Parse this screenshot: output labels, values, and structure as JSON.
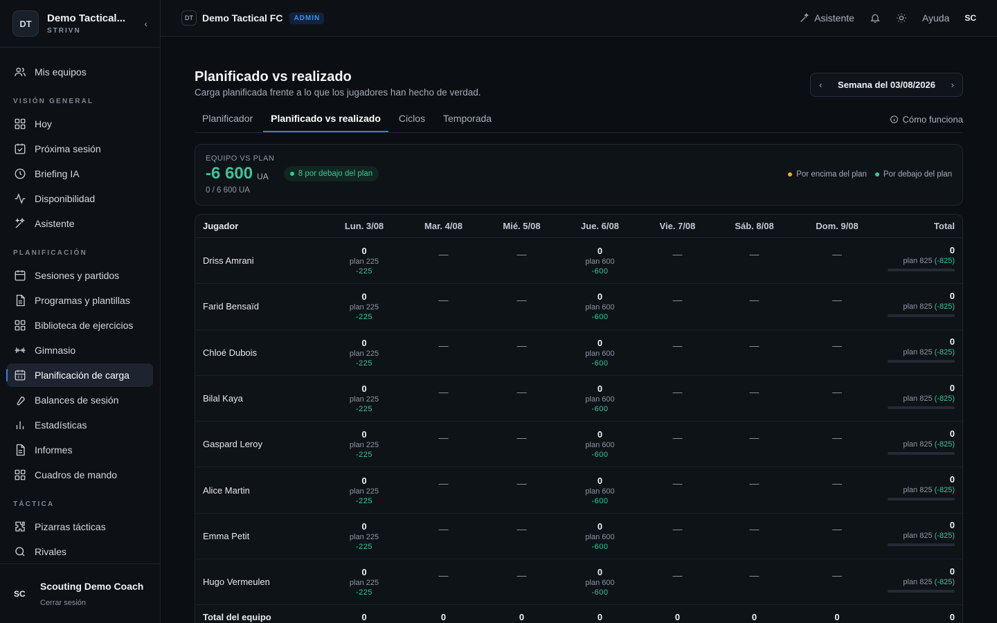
{
  "brand": {
    "logo": "DT",
    "name": "Demo Tactical...",
    "sub": "STRIVN"
  },
  "sidebar": {
    "top_item": {
      "label": "Mis equipos",
      "icon": "users-icon"
    },
    "sections": [
      {
        "title": "VISIÓN GENERAL",
        "items": [
          {
            "label": "Hoy",
            "icon": "grid-icon"
          },
          {
            "label": "Próxima sesión",
            "icon": "calendar-check-icon"
          },
          {
            "label": "Briefing IA",
            "icon": "clock-icon"
          },
          {
            "label": "Disponibilidad",
            "icon": "activity-icon"
          },
          {
            "label": "Asistente",
            "icon": "sparkle-icon"
          }
        ]
      },
      {
        "title": "PLANIFICACIÓN",
        "items": [
          {
            "label": "Sesiones y partidos",
            "icon": "calendar-icon"
          },
          {
            "label": "Programas y plantillas",
            "icon": "document-icon"
          },
          {
            "label": "Biblioteca de ejercicios",
            "icon": "grid-icon"
          },
          {
            "label": "Gimnasio",
            "icon": "dumbbell-icon"
          },
          {
            "label": "Planificación de carga",
            "icon": "calendar-grid-icon",
            "active": true
          },
          {
            "label": "Balances de sesión",
            "icon": "wrench-icon"
          },
          {
            "label": "Estadísticas",
            "icon": "bar-chart-icon"
          },
          {
            "label": "Informes",
            "icon": "document-icon"
          },
          {
            "label": "Cuadros de mando",
            "icon": "grid-icon"
          }
        ]
      },
      {
        "title": "TÁCTICA",
        "items": [
          {
            "label": "Pizarras tácticas",
            "icon": "puzzle-icon"
          },
          {
            "label": "Rivales",
            "icon": "search-icon"
          }
        ]
      }
    ]
  },
  "user": {
    "initials": "SC",
    "name": "Scouting Demo Coach",
    "logout": "Cerrar sesión"
  },
  "topbar": {
    "logo": "DT",
    "team": "Demo Tactical FC",
    "badge": "ADMIN",
    "assistant": "Asistente",
    "help": "Ayuda",
    "initials": "SC"
  },
  "page": {
    "title": "Planificado vs realizado",
    "subtitle": "Carga planificada frente a lo que los jugadores han hecho de verdad.",
    "week": "Semana del 03/08/2026",
    "tabs": [
      "Planificador",
      "Planificado vs realizado",
      "Ciclos",
      "Temporada"
    ],
    "active_tab": 1,
    "how": "Cómo funciona"
  },
  "summary": {
    "label": "EQUIPO VS PLAN",
    "value": "-6 600",
    "unit": "UA",
    "badge": "8 por debajo del plan",
    "total": "0 / 6 600 UA",
    "legend_above": "Por encima del plan",
    "legend_below": "Por debajo del plan",
    "color_above": "#f0a928",
    "color_below": "#3bc497"
  },
  "table": {
    "headers": [
      "Jugador",
      "Lun. 3/08",
      "Mar. 4/08",
      "Mié. 5/08",
      "Jue. 6/08",
      "Vie. 7/08",
      "Sáb. 8/08",
      "Dom. 9/08",
      "Total"
    ],
    "dash": "—",
    "players": [
      "Driss Amrani",
      "Farid Bensaïd",
      "Chloé Dubois",
      "Bilal Kaya",
      "Gaspard Leroy",
      "Alice Martin",
      "Emma Petit",
      "Hugo Vermeulen"
    ],
    "mon": {
      "value": "0",
      "plan": "plan 225",
      "delta": "-225"
    },
    "thu": {
      "value": "0",
      "plan": "plan 600",
      "delta": "-600"
    },
    "total": {
      "value": "0",
      "plan": "plan 825",
      "delta": "(-825)"
    },
    "team_total": {
      "label": "Total del equipo",
      "values": [
        "0",
        "0",
        "0",
        "0",
        "0",
        "0",
        "0",
        "0"
      ]
    }
  }
}
